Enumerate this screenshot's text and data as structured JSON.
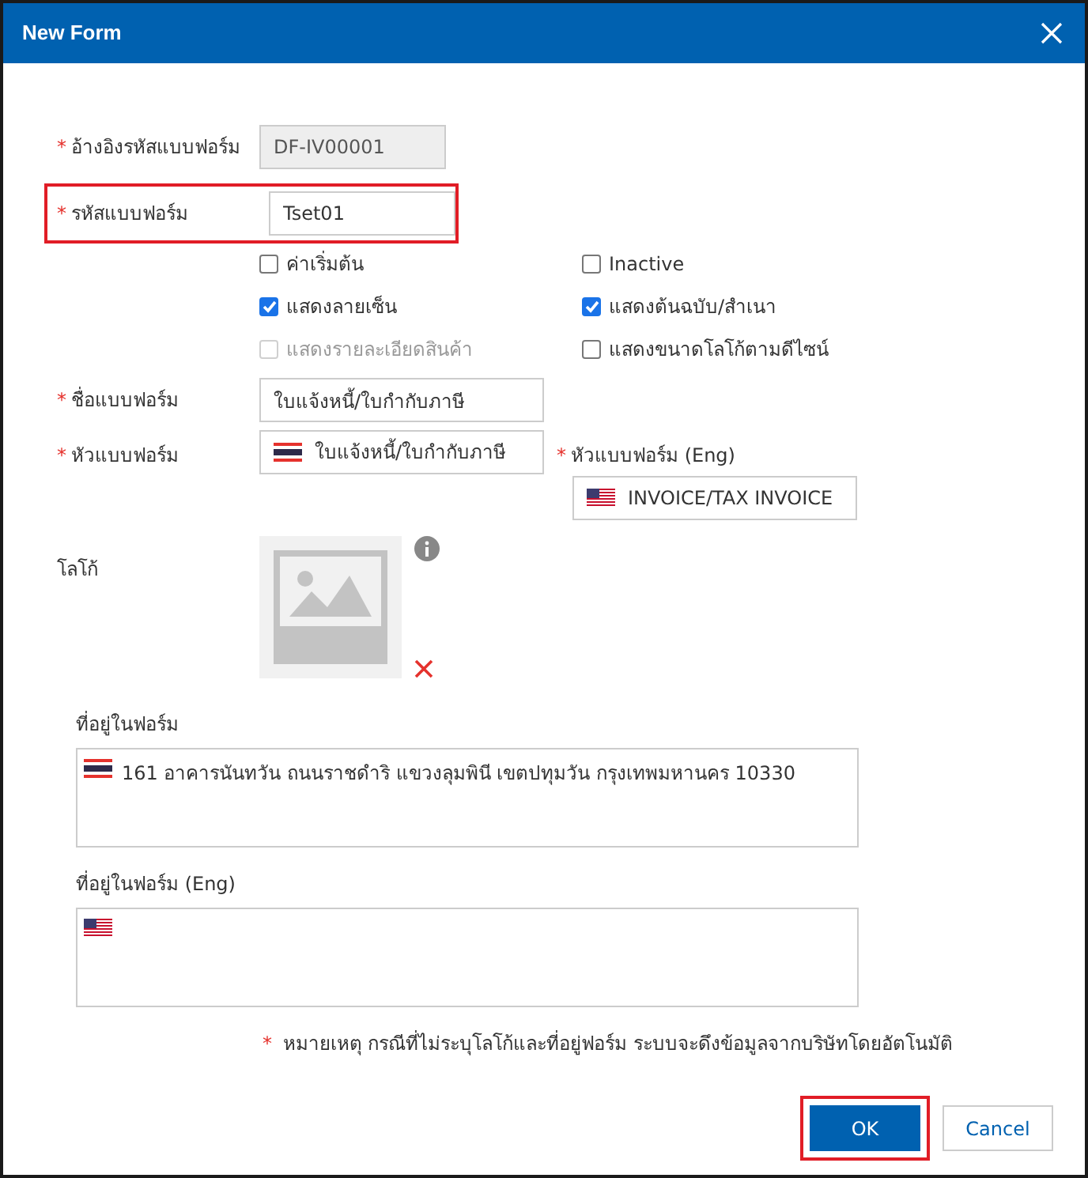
{
  "dialog": {
    "title": "New Form"
  },
  "required_mark": "*",
  "codes": [
    {
      "label": "อ้างอิงรหัสแบบฟอร์ม",
      "required": true,
      "value": "DF-IV00001",
      "disabled": true,
      "highlighted": false
    },
    {
      "label": "รหัสแบบฟอร์ม",
      "required": true,
      "value": "Tset01",
      "disabled": false,
      "highlighted": true
    }
  ],
  "options": [
    {
      "label": "ค่าเริ่มต้น",
      "checked": false,
      "disabled": false
    },
    {
      "label": "Inactive",
      "checked": false,
      "disabled": false
    },
    {
      "label": "แสดงลายเซ็น",
      "checked": true,
      "disabled": false
    },
    {
      "label": "แสดงต้นฉบับ/สำเนา",
      "checked": true,
      "disabled": false
    },
    {
      "label": "แสดงรายละเอียดสินค้า",
      "checked": false,
      "disabled": true
    },
    {
      "label": "แสดงขนาดโลโก้ตามดีไซน์",
      "checked": false,
      "disabled": false
    }
  ],
  "name_field": {
    "label": "ชื่อแบบฟอร์ม",
    "required": true,
    "value": "ใบแจ้งหนี้/ใบกำกับภาษี"
  },
  "header_field": {
    "label": "หัวแบบฟอร์ม",
    "required": true,
    "value": "ใบแจ้งหนี้/ใบกำกับภาษี"
  },
  "header_eng_field": {
    "label": "หัวแบบฟอร์ม (Eng)",
    "required": true,
    "value": "INVOICE/TAX INVOICE"
  },
  "logo": {
    "label": "โลโก้"
  },
  "address": {
    "label": "ที่อยู่ในฟอร์ม",
    "value": "161 อาคารนันทวัน ถนนราชดำริ แขวงลุมพินี เขตปทุมวัน กรุงเทพมหานคร 10330"
  },
  "address_eng": {
    "label": "ที่อยู่ในฟอร์ม (Eng)"
  },
  "note": {
    "mark": "*",
    "text": "หมายเหตุ กรณีที่ไม่ระบุโลโก้และที่อยู่ฟอร์ม ระบบจะดึงข้อมูลจากบริษัทโดยอัตโนมัติ"
  },
  "buttons": [
    {
      "label": "OK",
      "kind": "primary",
      "highlighted": true
    },
    {
      "label": "Cancel",
      "kind": "secondary",
      "highlighted": false
    }
  ]
}
